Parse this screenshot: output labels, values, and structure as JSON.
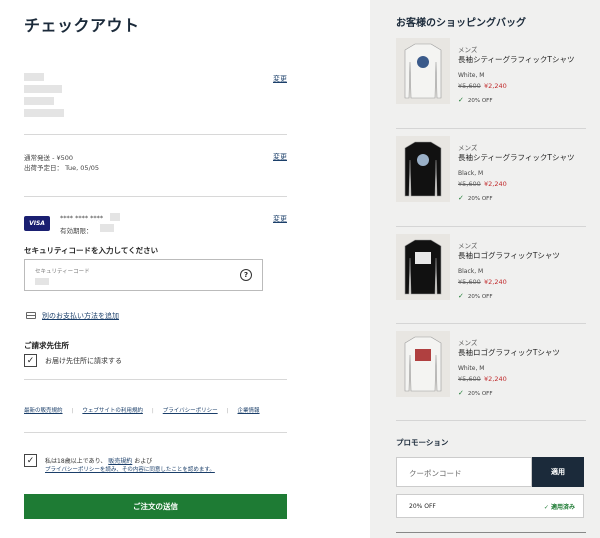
{
  "checkout": {
    "title": "チェックアウト",
    "change_label": "変更",
    "shipping": {
      "method": "通常発送 - ¥500",
      "eta": "出荷予定日： Tue, 05/05"
    },
    "payment": {
      "card_brand": "VISA",
      "card_number": "**** **** ****",
      "expiry_label": "有効期限："
    },
    "security": {
      "label": "セキュリティコードを入力してください",
      "placeholder": "セキュリティーコード",
      "help_glyph": "?"
    },
    "add_payment": "別のお支払い方法を追加",
    "billing": {
      "title": "ご請求先住所",
      "same_as_shipping": "お届け先住所に請求する"
    },
    "links": [
      "最新の販売規約",
      "ウェブサイトの利用規約",
      "プライバシーポリシー",
      "企業情報"
    ],
    "agreement": {
      "line1_prefix": "私は18歳以上であり、",
      "line1_link": "販売規約",
      "line1_suffix": "および",
      "line2": "プライバシーポリシーを読み、その内容に同意したことを認めます。"
    },
    "submit_label": "ご注文の送信",
    "checkmark": "✓"
  },
  "bag": {
    "title": "お客様のショッピングバッグ",
    "items": [
      {
        "category": "メンズ",
        "name": "長袖シティーグラフィックTシャツ",
        "color_size": "White, M",
        "old_price": "¥5,600",
        "new_price": "¥2,240",
        "discount": "20% OFF",
        "shirt_color": "#f4f4f2",
        "print_color": "#3a5a8a"
      },
      {
        "category": "メンズ",
        "name": "長袖シティーグラフィックTシャツ",
        "color_size": "Black, M",
        "old_price": "¥5,600",
        "new_price": "¥2,240",
        "discount": "20% OFF",
        "shirt_color": "#111111",
        "print_color": "#9ab0c8"
      },
      {
        "category": "メンズ",
        "name": "長袖ロゴグラフィックTシャツ",
        "color_size": "Black, M",
        "old_price": "¥5,600",
        "new_price": "¥2,240",
        "discount": "20% OFF",
        "shirt_color": "#111111",
        "print_color": "#e8e8e8"
      },
      {
        "category": "メンズ",
        "name": "長袖ロゴグラフィックTシャツ",
        "color_size": "White, M",
        "old_price": "¥5,600",
        "new_price": "¥2,240",
        "discount": "20% OFF",
        "shirt_color": "#f4f4f2",
        "print_color": "#b04040"
      }
    ]
  },
  "promotion": {
    "title": "プロモーション",
    "coupon_placeholder": "クーポンコード",
    "apply_label": "適用",
    "applied_code": "20% OFF",
    "applied_status": "✓ 適用済み"
  },
  "colors": {
    "brand_green": "#1e7b34",
    "navy": "#1b2a3a",
    "sale_red": "#c0292b"
  }
}
